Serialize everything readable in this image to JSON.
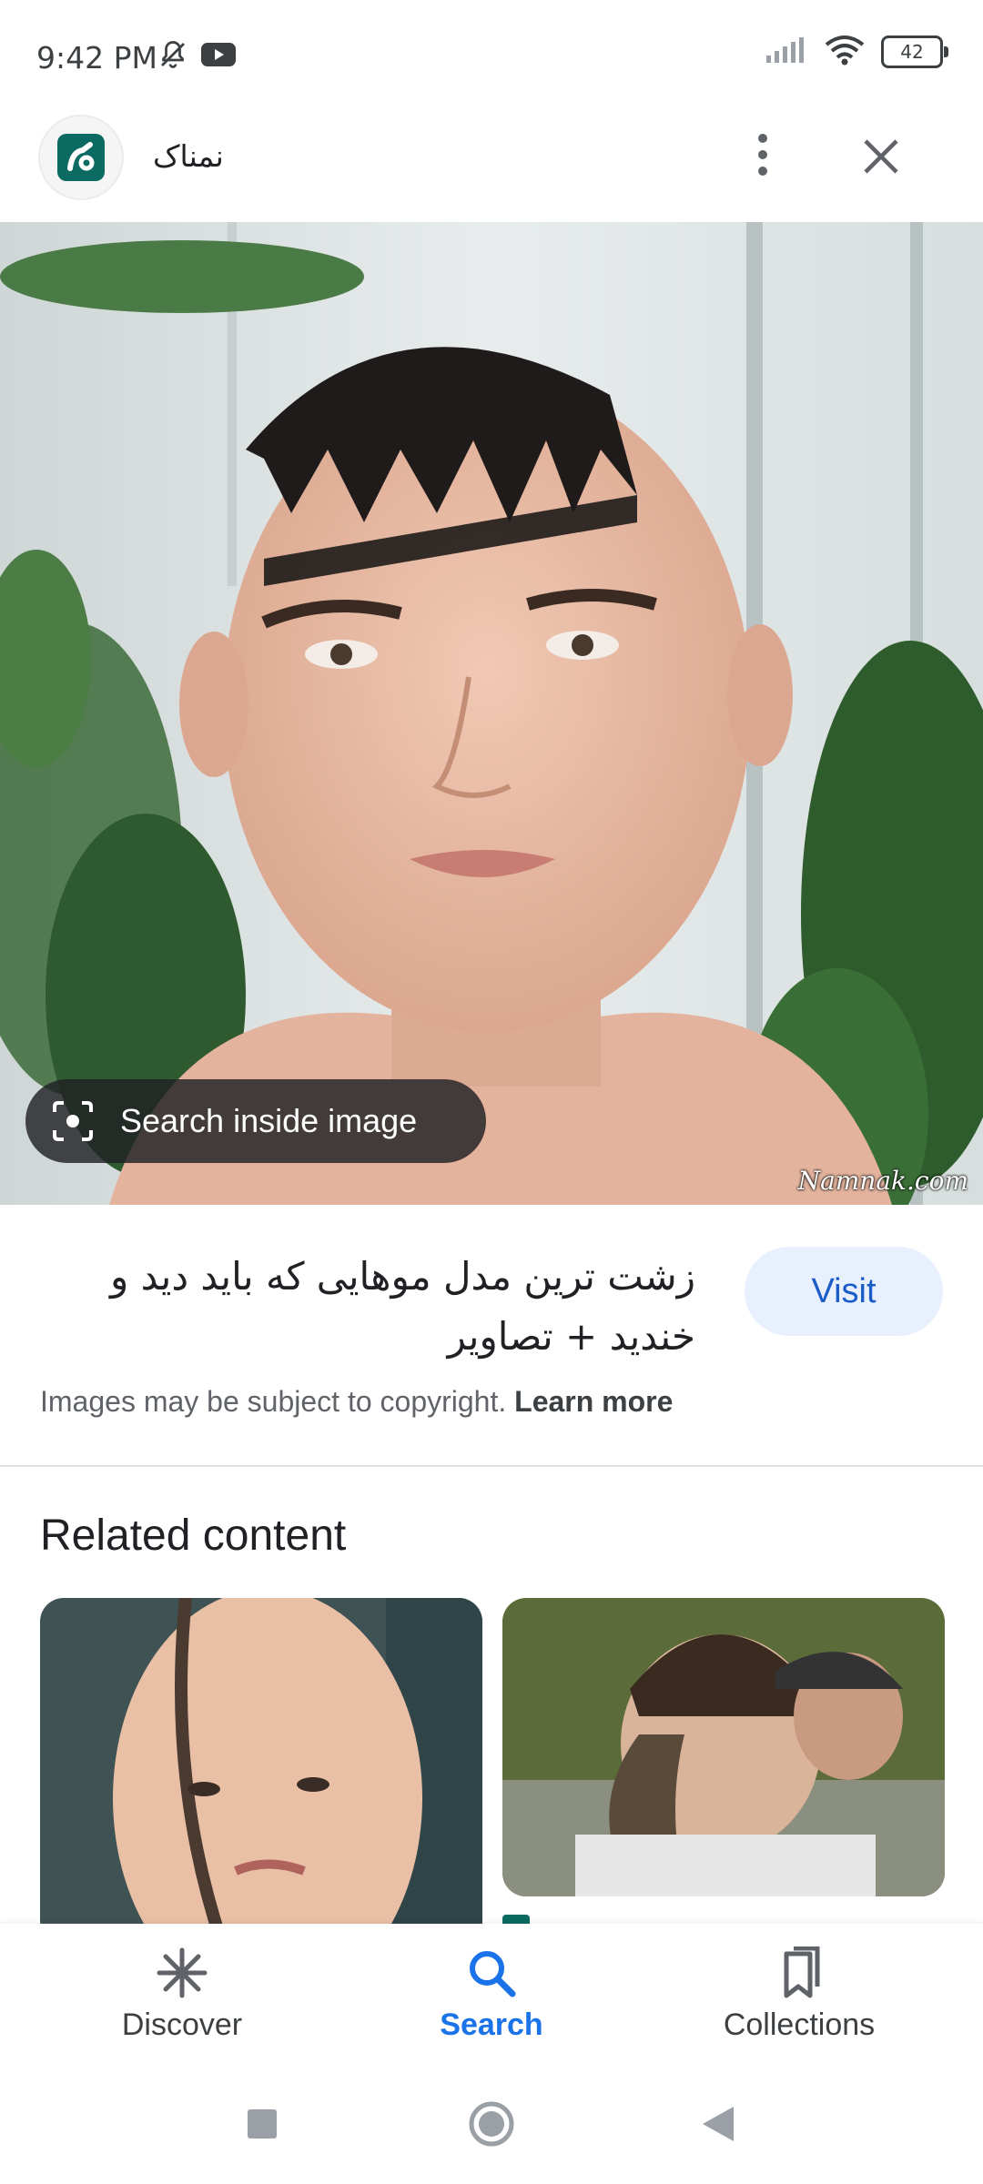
{
  "status_bar": {
    "time": "9:42 PM",
    "battery_level": "42",
    "icons": [
      "mute-icon",
      "youtube-icon",
      "signal-icon",
      "wifi-icon",
      "battery-icon"
    ]
  },
  "header": {
    "site_name": "نمناک",
    "menu_icon": "more-vert-icon",
    "close_icon": "close-icon"
  },
  "image": {
    "watermark": "Namnak.com",
    "lens_chip_label": "Search inside image"
  },
  "result": {
    "title": "زشت ترین مدل موهایی که باید دید و خندید + تصاویر",
    "visit_label": "Visit",
    "copyright_text": "Images may be subject to copyright.",
    "learn_more": "Learn more"
  },
  "related": {
    "heading": "Related content"
  },
  "bottom_nav": {
    "items": [
      {
        "label": "Discover",
        "icon": "asterisk-icon"
      },
      {
        "label": "Search",
        "icon": "search-icon",
        "selected": true
      },
      {
        "label": "Collections",
        "icon": "bookmarks-icon"
      }
    ]
  },
  "colors": {
    "accent": "#1a73e8",
    "visit_bg": "#e8f0fe",
    "site_logo": "#0b6b62"
  }
}
